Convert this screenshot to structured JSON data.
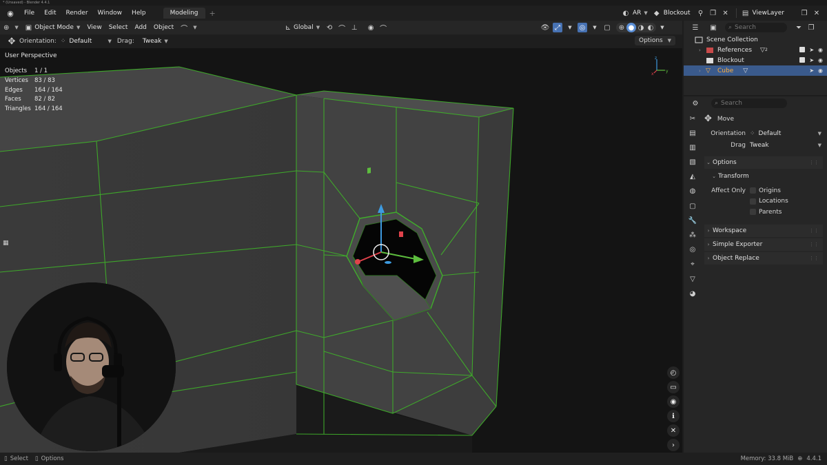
{
  "window": {
    "title": "* (Unsaved) - Blender 4.4.1"
  },
  "menu": {
    "items": [
      "File",
      "Edit",
      "Render",
      "Window",
      "Help"
    ],
    "workspace_tab": "Modeling",
    "add_tab": "+"
  },
  "topbar_right": {
    "language": "AR",
    "scene": "Blockout",
    "view_layer": "ViewLayer"
  },
  "viewport_header": {
    "mode": "Object Mode",
    "view": "View",
    "select": "Select",
    "add": "Add",
    "object": "Object",
    "transform_orientation": "Global"
  },
  "tool_settings": {
    "orientation_label": "Orientation:",
    "orientation_value": "Default",
    "drag_label": "Drag:",
    "drag_value": "Tweak",
    "options": "Options"
  },
  "viewport": {
    "perspective": "User Perspective",
    "stats": [
      {
        "key": "Objects",
        "value": "1 / 1"
      },
      {
        "key": "Vertices",
        "value": "83 / 83"
      },
      {
        "key": "Edges",
        "value": "164 / 164"
      },
      {
        "key": "Faces",
        "value": "82 / 82"
      },
      {
        "key": "Triangles",
        "value": "164 / 164"
      }
    ],
    "gizmo_axes": {
      "x": "x",
      "y": "y",
      "z": "z"
    },
    "colors": {
      "wire": "#3fae2a",
      "x": "#e0424b",
      "y": "#5dbd3e",
      "z": "#3d9be0"
    }
  },
  "outliner": {
    "search_placeholder": "Search",
    "scene_collection": "Scene Collection",
    "rows": [
      {
        "name": "References",
        "badge": "2"
      },
      {
        "name": "Blockout"
      },
      {
        "name": "Cube"
      }
    ]
  },
  "properties": {
    "search_placeholder": "Search",
    "tool_name": "Move",
    "orientation_label": "Orientation",
    "orientation_value": "Default",
    "drag_label": "Drag",
    "drag_value": "Tweak",
    "options_panel": "Options",
    "transform_panel": "Transform",
    "affect_only_label": "Affect Only",
    "affect_only": [
      "Origins",
      "Locations",
      "Parents"
    ],
    "panels": [
      "Workspace",
      "Simple Exporter",
      "Object Replace"
    ]
  },
  "statusbar": {
    "select": "Select",
    "options": "Options",
    "memory": "Memory: 33.8 MiB",
    "version": "4.4.1"
  }
}
